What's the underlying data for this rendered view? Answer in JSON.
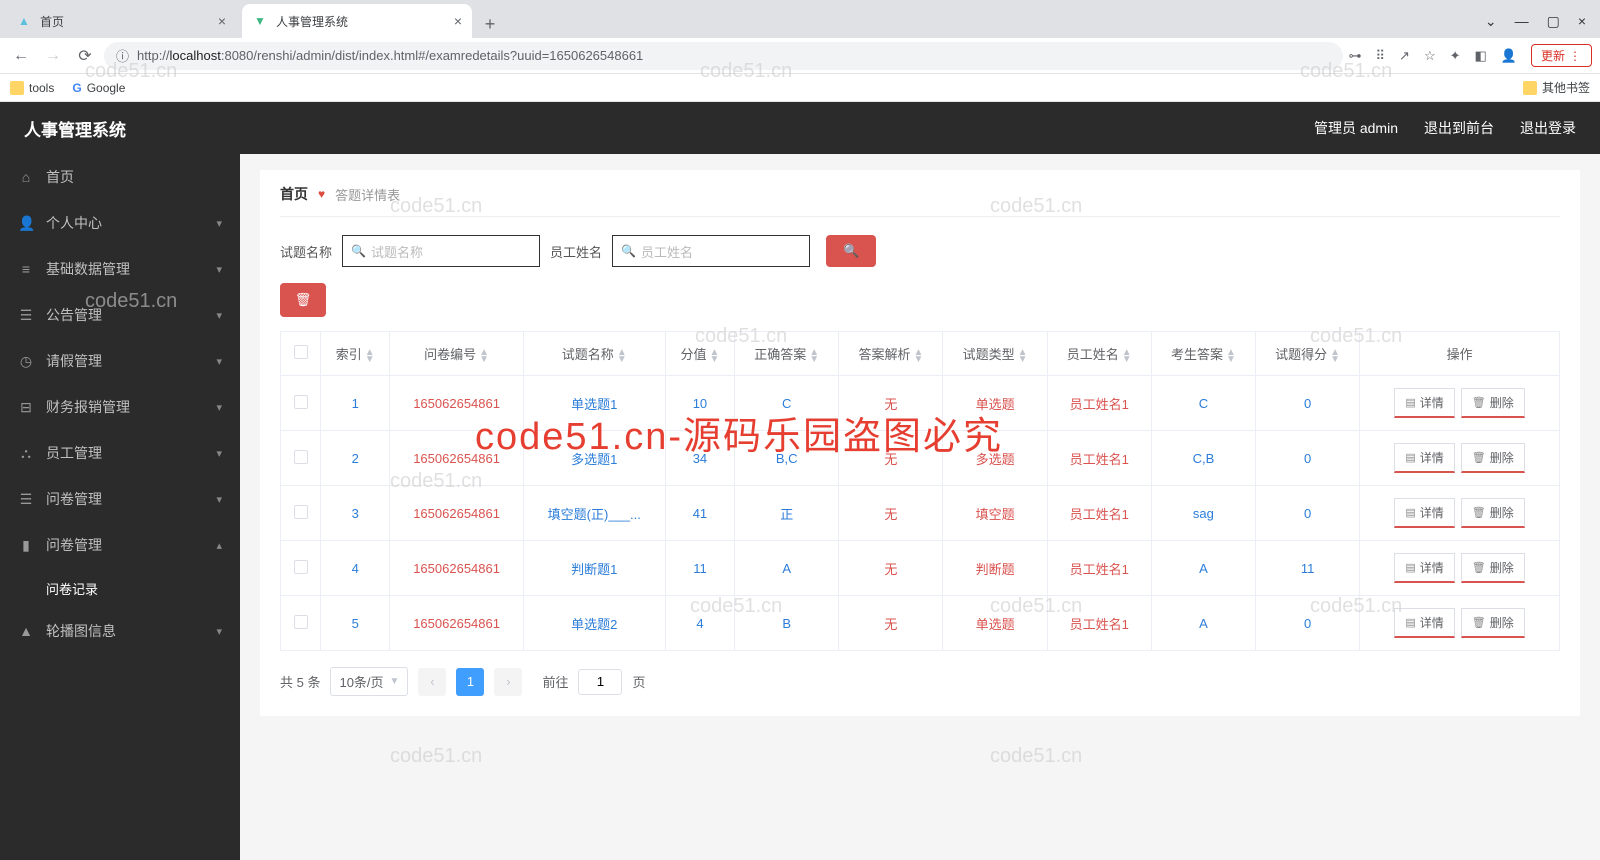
{
  "browser": {
    "tabs": [
      {
        "title": "首页",
        "fav_color": "#5bc0de"
      },
      {
        "title": "人事管理系统",
        "fav_type": "vue"
      }
    ],
    "url_host": "localhost",
    "url_prefix": "http://",
    "url_port_path": ":8080/renshi/admin/dist/index.html#/examredetails?uuid=1650626548661",
    "update_label": "更新",
    "bookmarks": {
      "tools": "tools",
      "google": "Google",
      "other": "其他书签"
    }
  },
  "app": {
    "title": "人事管理系统",
    "user_label": "管理员 admin",
    "to_front": "退出到前台",
    "logout": "退出登录"
  },
  "sidebar": {
    "items": [
      {
        "icon": "home",
        "label": "首页",
        "expandable": false
      },
      {
        "icon": "user",
        "label": "个人中心",
        "expandable": true
      },
      {
        "icon": "db",
        "label": "基础数据管理",
        "expandable": true
      },
      {
        "icon": "list",
        "label": "公告管理",
        "expandable": true
      },
      {
        "icon": "clock",
        "label": "请假管理",
        "expandable": true
      },
      {
        "icon": "money",
        "label": "财务报销管理",
        "expandable": true
      },
      {
        "icon": "emp",
        "label": "员工管理",
        "expandable": true
      },
      {
        "icon": "list",
        "label": "问卷管理",
        "expandable": true
      },
      {
        "icon": "bar",
        "label": "问卷管理",
        "expandable": true,
        "open": true
      },
      {
        "icon": "img",
        "label": "轮播图信息",
        "expandable": true
      }
    ],
    "sub_label": "问卷记录"
  },
  "crumb": {
    "home": "首页",
    "current": "答题详情表"
  },
  "filter": {
    "f1_label": "试题名称",
    "f1_ph": "试题名称",
    "f2_label": "员工姓名",
    "f2_ph": "员工姓名"
  },
  "table": {
    "headers": [
      "索引",
      "问卷编号",
      "试题名称",
      "分值",
      "正确答案",
      "答案解析",
      "试题类型",
      "员工姓名",
      "考生答案",
      "试题得分",
      "操作"
    ],
    "op_detail": "详情",
    "op_delete": "删除",
    "rows": [
      {
        "idx": "1",
        "qid": "165062654861",
        "name": "单选题1",
        "score": "10",
        "ans": "C",
        "exp": "无",
        "type": "单选题",
        "emp": "员工姓名1",
        "uans": "C",
        "got": "0"
      },
      {
        "idx": "2",
        "qid": "165062654861",
        "name": "多选题1",
        "score": "34",
        "ans": "B,C",
        "exp": "无",
        "type": "多选题",
        "emp": "员工姓名1",
        "uans": "C,B",
        "got": "0"
      },
      {
        "idx": "3",
        "qid": "165062654861",
        "name": "填空题(正)___...",
        "score": "41",
        "ans": "正",
        "exp": "无",
        "type": "填空题",
        "emp": "员工姓名1",
        "uans": "sag",
        "got": "0"
      },
      {
        "idx": "4",
        "qid": "165062654861",
        "name": "判断题1",
        "score": "11",
        "ans": "A",
        "exp": "无",
        "type": "判断题",
        "emp": "员工姓名1",
        "uans": "A",
        "got": "11"
      },
      {
        "idx": "5",
        "qid": "165062654861",
        "name": "单选题2",
        "score": "4",
        "ans": "B",
        "exp": "无",
        "type": "单选题",
        "emp": "员工姓名1",
        "uans": "A",
        "got": "0"
      }
    ]
  },
  "pager": {
    "total_label": "共 5 条",
    "per_page": "10条/页",
    "page": "1",
    "goto_prefix": "前往",
    "goto_val": "1",
    "goto_suffix": "页"
  },
  "watermark": "code51.cn",
  "big_watermark": "code51.cn-源码乐园盗图必究"
}
